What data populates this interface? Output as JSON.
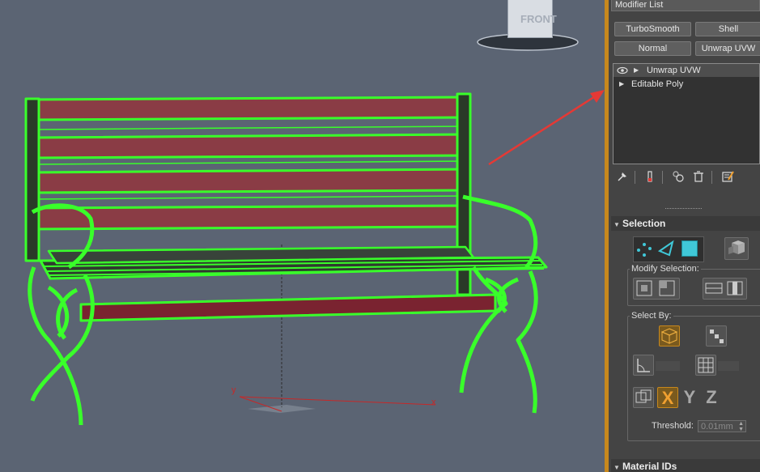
{
  "viewcube": {
    "face_label": "FRONT"
  },
  "gizmo": {
    "x_label": "x",
    "y_label": "y"
  },
  "panel": {
    "modifier_list_label": "Modifier List",
    "quick_buttons": [
      "TurboSmooth",
      "Shell",
      "Normal",
      "Unwrap UVW"
    ],
    "stack": [
      {
        "label": "Unwrap UVW",
        "selected": true
      },
      {
        "label": "Editable Poly",
        "selected": false
      }
    ],
    "toolbar_icons": [
      "pin-stack-icon",
      "show-end-result-icon",
      "make-unique-icon",
      "remove-modifier-icon",
      "configure-sets-icon"
    ]
  },
  "selection_rollout": {
    "title": "Selection",
    "modify_selection_label": "Modify Selection:",
    "select_by_label": "Select By:",
    "axes": [
      "X",
      "Y",
      "Z"
    ],
    "threshold_label": "Threshold:",
    "threshold_value": "0.01mm"
  },
  "material_ids_rollout": {
    "title": "Material IDs"
  },
  "colors": {
    "accent": "#c7881d",
    "wireframe": "#39ff2a",
    "slat": "#8a3c45",
    "viewport_bg": "#5b6473"
  }
}
